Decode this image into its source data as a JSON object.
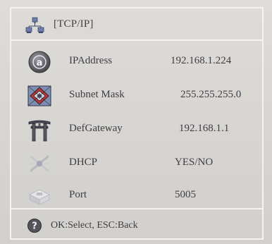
{
  "header": {
    "title": "[TCP/IP]",
    "icon": "network-computers-icon"
  },
  "settings": [
    {
      "label": "IPAddress",
      "value": "192.168.1.224",
      "icon": "ip-address-icon"
    },
    {
      "label": "Subnet Mask",
      "value": "255.255.255.0",
      "icon": "subnet-mask-icon"
    },
    {
      "label": "DefGateway",
      "value": "192.168.1.1",
      "icon": "gateway-icon"
    },
    {
      "label": "DHCP",
      "value": "YES/NO",
      "icon": "dhcp-icon"
    },
    {
      "label": "Port",
      "value": "5005",
      "icon": "port-icon"
    }
  ],
  "footer": {
    "hint": "OK:Select, ESC:Back",
    "icon": "help-icon"
  },
  "colors": {
    "background": "#d9d7d2",
    "lines": "#f4f3f1",
    "text": "#3f3d45"
  }
}
